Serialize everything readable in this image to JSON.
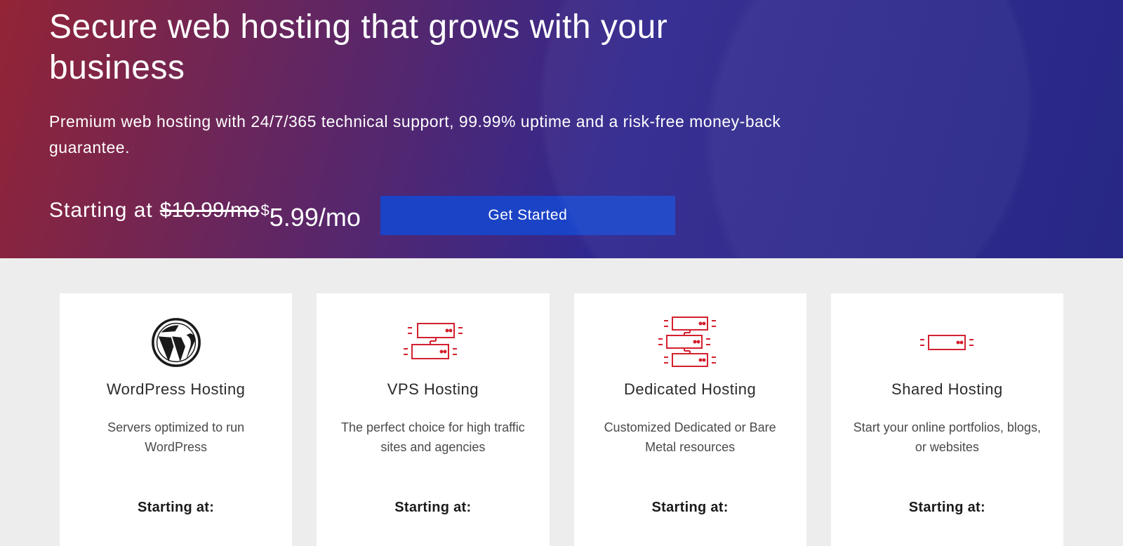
{
  "hero": {
    "title": "Secure web hosting that grows with your business",
    "subtitle": "Premium web hosting with 24/7/365 technical support, 99.99% uptime and a risk-free money-back guarantee.",
    "starting_label": "Starting at",
    "old_price": "$10.99/mo",
    "currency": "$",
    "new_price": "5.99/mo",
    "cta_label": "Get Started"
  },
  "plans": [
    {
      "icon": "wordpress",
      "title": "WordPress Hosting",
      "desc": "Servers optimized to run WordPress",
      "starting": "Starting at:"
    },
    {
      "icon": "servers-2",
      "title": "VPS Hosting",
      "desc": "The perfect choice for high traffic sites and agencies",
      "starting": "Starting at:"
    },
    {
      "icon": "servers-3",
      "title": "Dedicated Hosting",
      "desc": "Customized Dedicated or Bare Metal resources",
      "starting": "Starting at:"
    },
    {
      "icon": "servers-1",
      "title": "Shared Hosting",
      "desc": "Start your online portfolios, blogs, or websites",
      "starting": "Starting at:"
    }
  ]
}
